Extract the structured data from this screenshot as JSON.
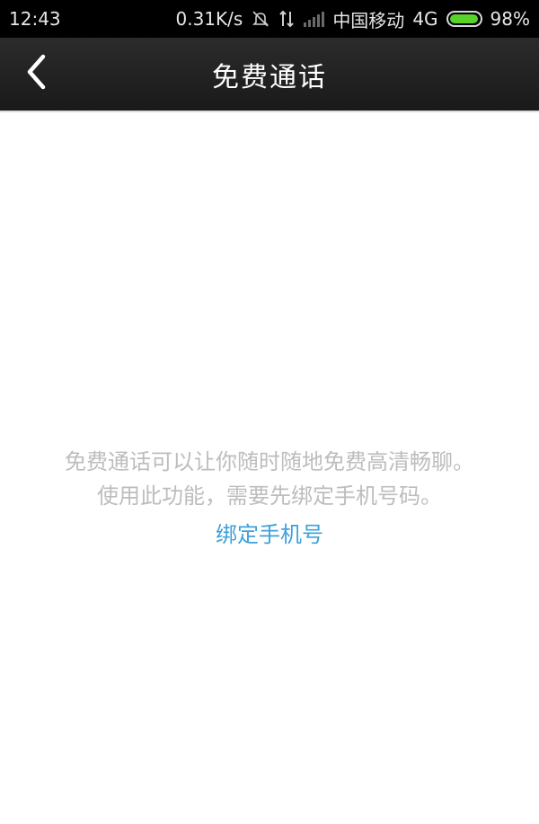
{
  "status_bar": {
    "time": "12:43",
    "network_speed": "0.31K/s",
    "carrier": "中国移动",
    "network_type": "4G",
    "battery_percent": "98%",
    "battery_level": 0.98,
    "icons": [
      "mute-icon",
      "data-transfer-icon",
      "signal-icon",
      "battery-icon"
    ]
  },
  "header": {
    "title": "免费通话",
    "back_icon": "chevron-left-icon"
  },
  "main": {
    "message_line1": "免费通话可以让你随时随地免费高清畅聊。",
    "message_line2": "使用此功能，需要先绑定手机号码。",
    "bind_link": "绑定手机号"
  },
  "colors": {
    "status_bar_bg": "#000000",
    "title_bar_bg": "#222222",
    "message_text": "#bdbdbd",
    "link": "#3ea1da",
    "battery": "#58d32a"
  }
}
